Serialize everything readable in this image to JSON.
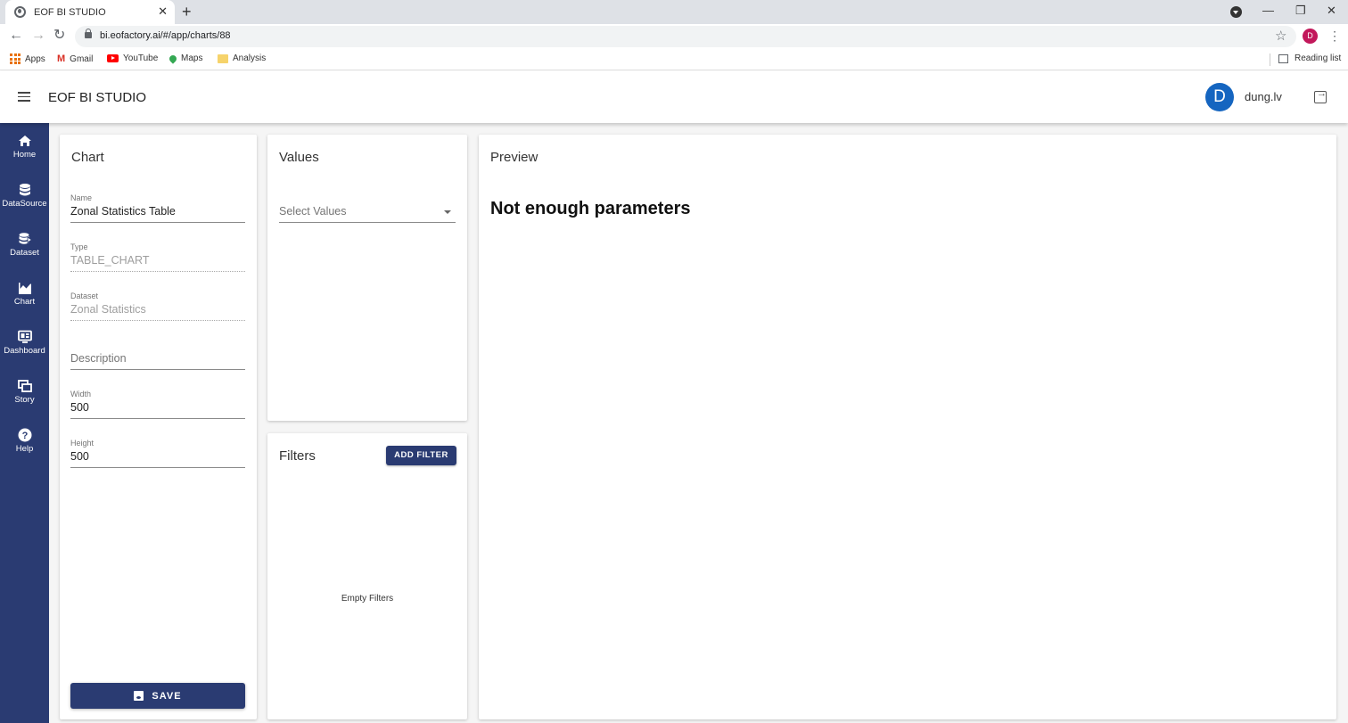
{
  "browser": {
    "tab_title": "EOF BI STUDIO",
    "tab_close": "✕",
    "new_tab": "+",
    "url": "bi.eofactory.ai/#/app/charts/88",
    "profile_initial": "D",
    "bookmarks": [
      {
        "label": "Apps",
        "icon": "apps-grid-icon"
      },
      {
        "label": "Gmail",
        "icon": "gmail-icon"
      },
      {
        "label": "YouTube",
        "icon": "youtube-icon"
      },
      {
        "label": "Maps",
        "icon": "maps-icon"
      },
      {
        "label": "Analysis",
        "icon": "folder-icon"
      }
    ],
    "reading_list": "Reading list"
  },
  "appbar": {
    "title": "EOF BI STUDIO",
    "avatar_initial": "D",
    "username": "dung.lv"
  },
  "sidenav": {
    "items": [
      {
        "label": "Home",
        "icon": "home-icon"
      },
      {
        "label": "DataSource",
        "icon": "database-icon"
      },
      {
        "label": "Dataset",
        "icon": "dataset-icon"
      },
      {
        "label": "Chart",
        "icon": "chart-icon"
      },
      {
        "label": "Dashboard",
        "icon": "dashboard-icon"
      },
      {
        "label": "Story",
        "icon": "story-icon"
      },
      {
        "label": "Help",
        "icon": "help-icon"
      }
    ]
  },
  "chart_panel": {
    "title": "Chart",
    "name_label": "Name",
    "name_value": "Zonal Statistics Table",
    "type_label": "Type",
    "type_value": "TABLE_CHART",
    "dataset_label": "Dataset",
    "dataset_value": "Zonal Statistics",
    "description_placeholder": "Description",
    "width_label": "Width",
    "width_value": "500",
    "height_label": "Height",
    "height_value": "500",
    "save_label": "SAVE"
  },
  "values_panel": {
    "title": "Values",
    "select_placeholder": "Select Values"
  },
  "filters_panel": {
    "title": "Filters",
    "add_filter_label": "ADD FILTER",
    "empty_text": "Empty Filters"
  },
  "preview_panel": {
    "title": "Preview",
    "message": "Not enough parameters"
  },
  "colors": {
    "primary": "#2a3b72",
    "avatar": "#1565c0",
    "profile": "#c2185b"
  }
}
